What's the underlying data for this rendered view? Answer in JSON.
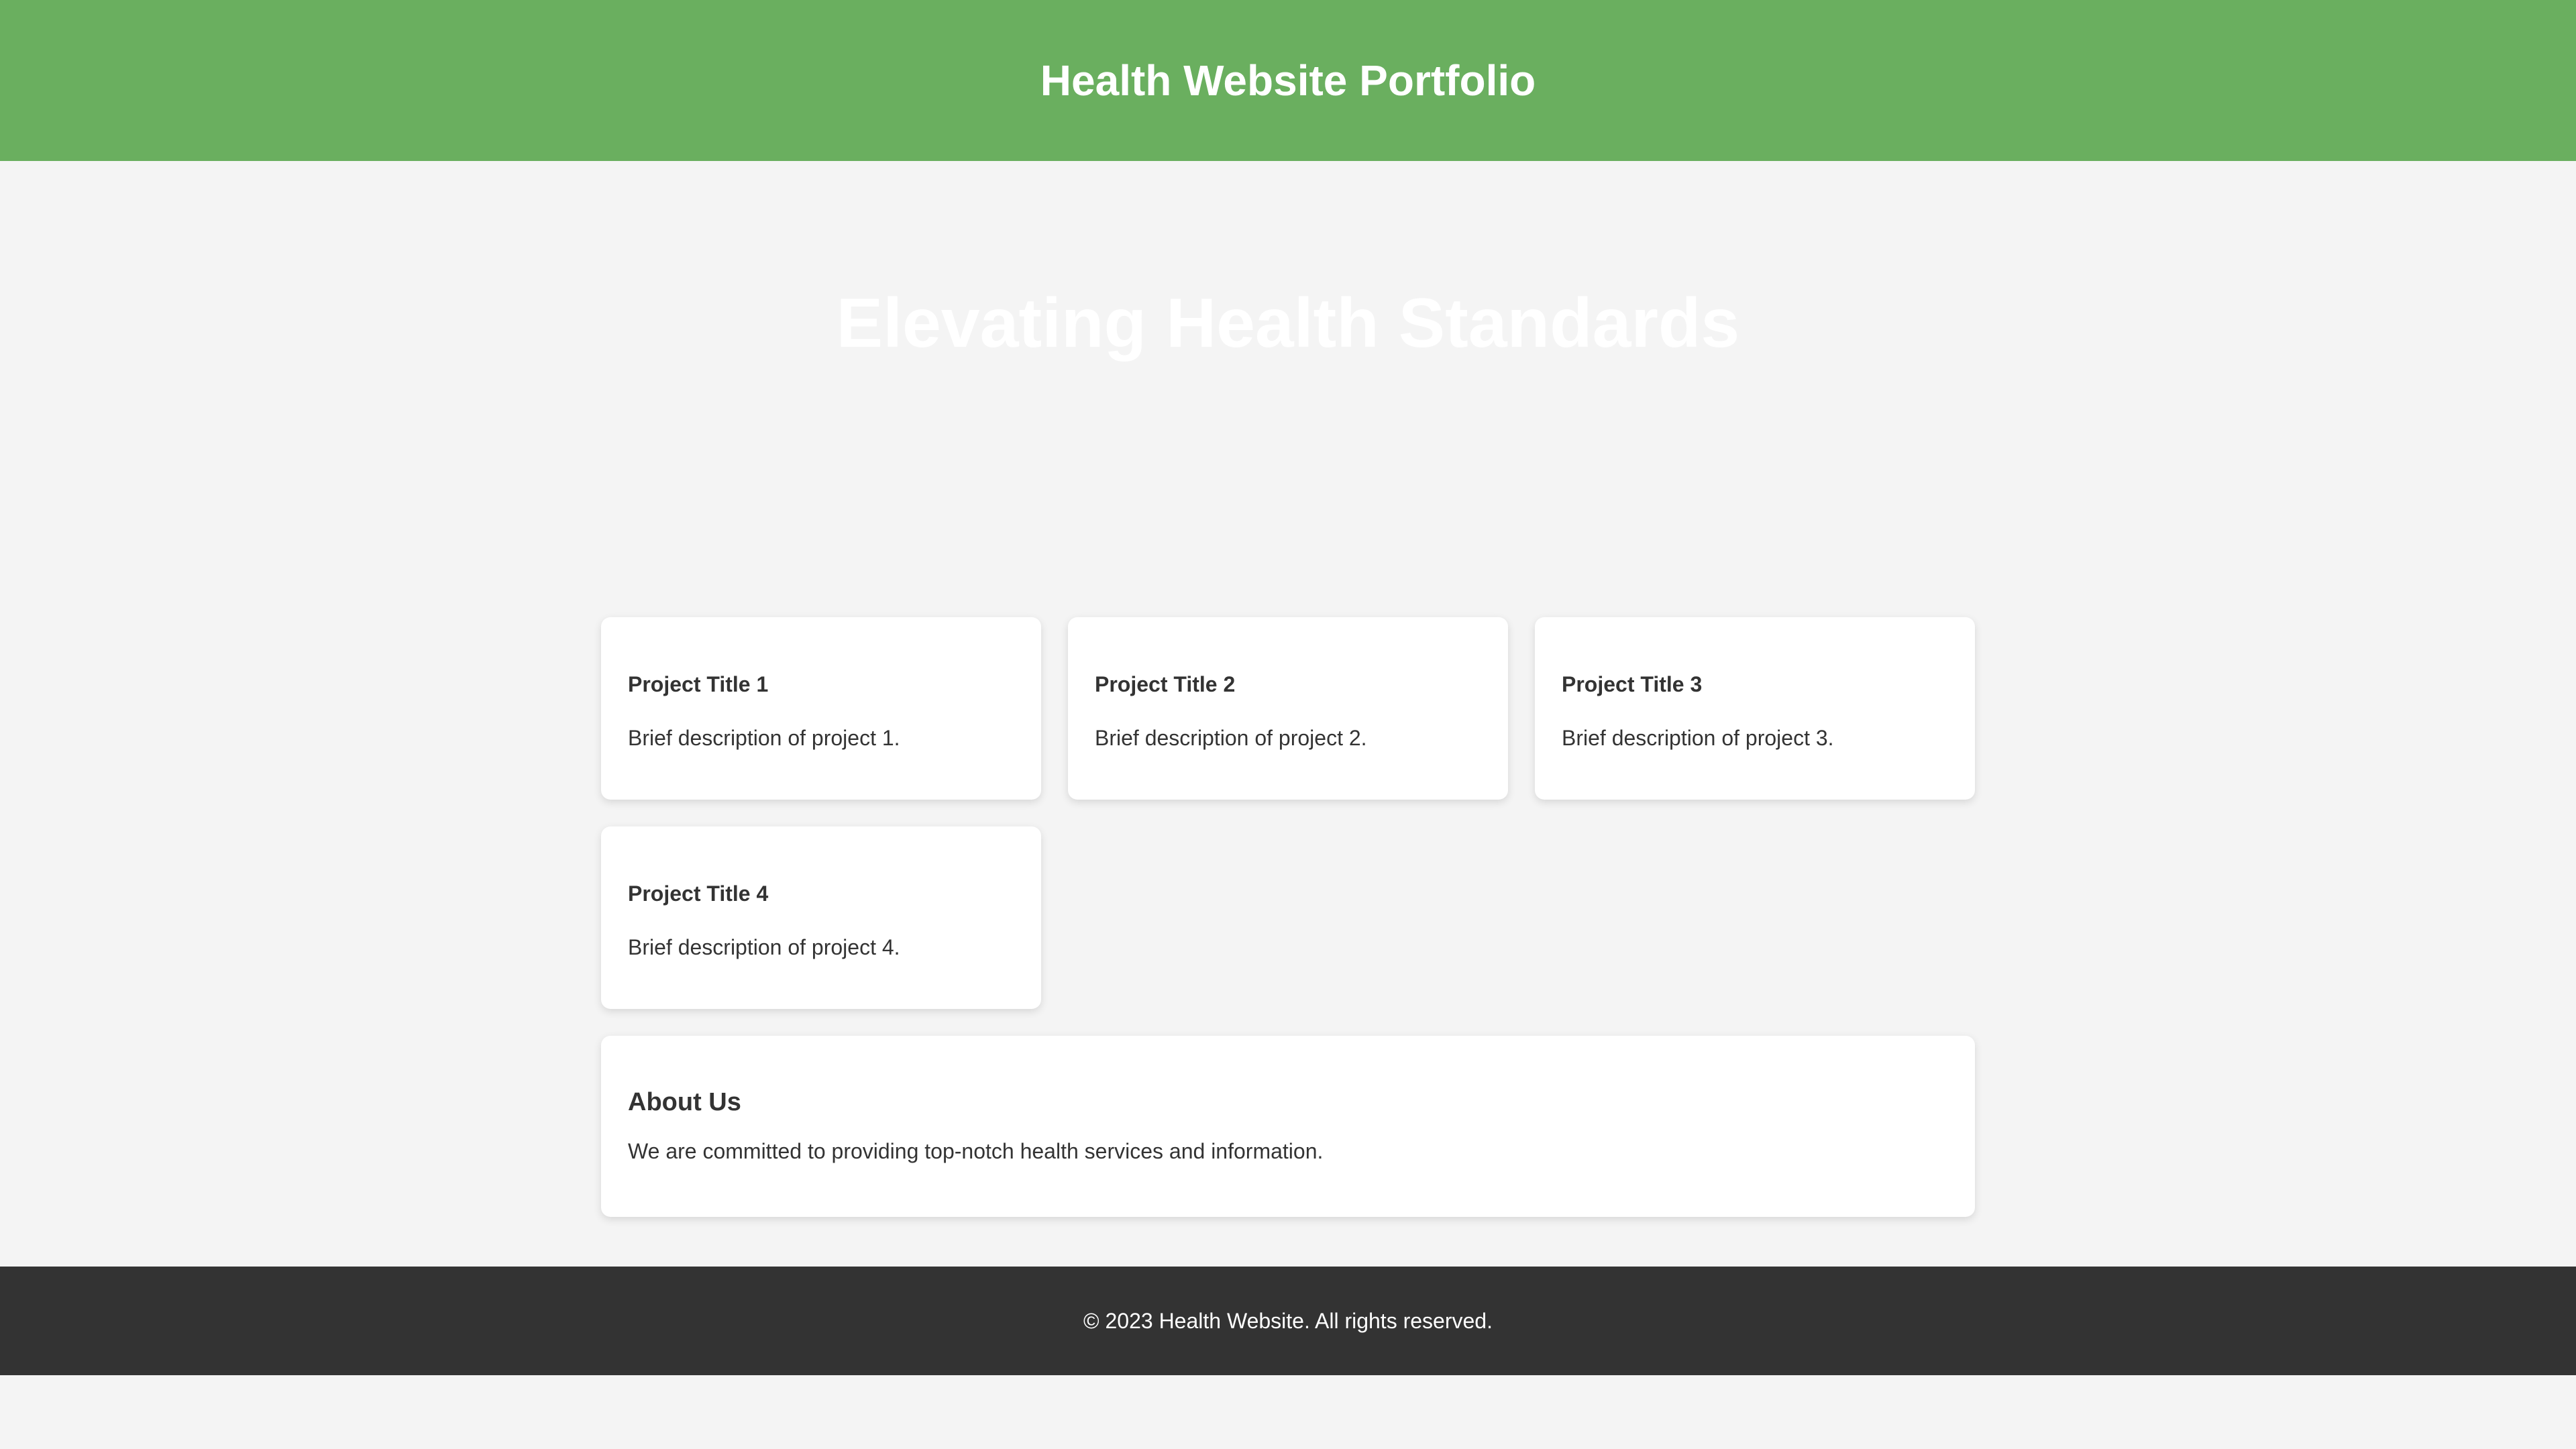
{
  "header": {
    "title": "Health Website Portfolio"
  },
  "hero": {
    "heading": "Elevating Health Standards"
  },
  "projects": [
    {
      "title": "Project Title 1",
      "description": "Brief description of project 1."
    },
    {
      "title": "Project Title 2",
      "description": "Brief description of project 2."
    },
    {
      "title": "Project Title 3",
      "description": "Brief description of project 3."
    },
    {
      "title": "Project Title 4",
      "description": "Brief description of project 4."
    }
  ],
  "about": {
    "title": "About Us",
    "text": "We are committed to providing top-notch health services and information."
  },
  "footer": {
    "text": "© 2023 Health Website. All rights reserved."
  },
  "colors": {
    "header_bg": "#6aaf5f",
    "page_bg": "#f4f4f4",
    "footer_bg": "#333333",
    "card_bg": "#ffffff",
    "text": "#333333"
  }
}
